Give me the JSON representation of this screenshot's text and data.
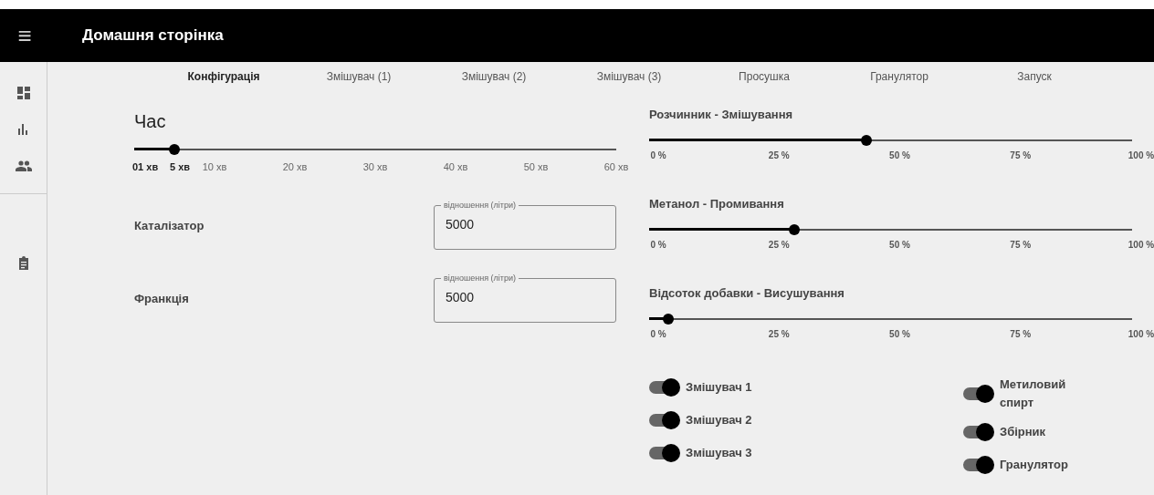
{
  "app_bar": {
    "title": "Домашня сторінка",
    "menu_icon": "≡"
  },
  "tabs": [
    {
      "label": "Конфігурація",
      "selected": true
    },
    {
      "label": "Змішувач (1)",
      "selected": false
    },
    {
      "label": "Змішувач (2)",
      "selected": false
    },
    {
      "label": "Змішувач (3)",
      "selected": false
    },
    {
      "label": "Просушка",
      "selected": false
    },
    {
      "label": "Гранулятор",
      "selected": false
    },
    {
      "label": "Запуск",
      "selected": false
    }
  ],
  "time": {
    "title": "Час",
    "level": 0.083,
    "marks": [
      {
        "label": "01 хв",
        "active": true
      },
      {
        "label": "5 хв",
        "active": true
      },
      {
        "label": "10 хв",
        "active": false
      },
      {
        "label": "20 хв",
        "active": false
      },
      {
        "label": "30 хв",
        "active": false
      },
      {
        "label": "40 хв",
        "active": false
      },
      {
        "label": "50 хв",
        "active": false
      },
      {
        "label": "60 хв",
        "active": false
      }
    ]
  },
  "fields": [
    {
      "label": "Каталізатор",
      "field_label": "відношення (літри)",
      "value": "5000"
    },
    {
      "label": "Франкція",
      "field_label": "відношення (літри)",
      "value": "5000"
    }
  ],
  "sliders": [
    {
      "title": "Розчинник - Змішування",
      "level": 0.45,
      "marks": [
        "0 %",
        "25 %",
        "50 %",
        "75 %",
        "100 %"
      ]
    },
    {
      "title": "Метанол - Промивання",
      "level": 0.3,
      "marks": [
        "0 %",
        "25 %",
        "50 %",
        "75 %",
        "100 %"
      ]
    },
    {
      "title": "Відсоток добавки - Висушування",
      "level": 0.04,
      "marks": [
        "0 %",
        "25 %",
        "50 %",
        "75 %",
        "100 %"
      ]
    }
  ],
  "toggles_left": [
    {
      "label": "Змішувач 1",
      "on": true
    },
    {
      "label": "Змішувач 2",
      "on": true
    },
    {
      "label": "Змішувач 3",
      "on": true
    }
  ],
  "toggles_right": [
    {
      "label": "Метиловий спирт",
      "on": true
    },
    {
      "label": "Збірник",
      "on": true
    },
    {
      "label": "Гранулятор",
      "on": true
    }
  ]
}
